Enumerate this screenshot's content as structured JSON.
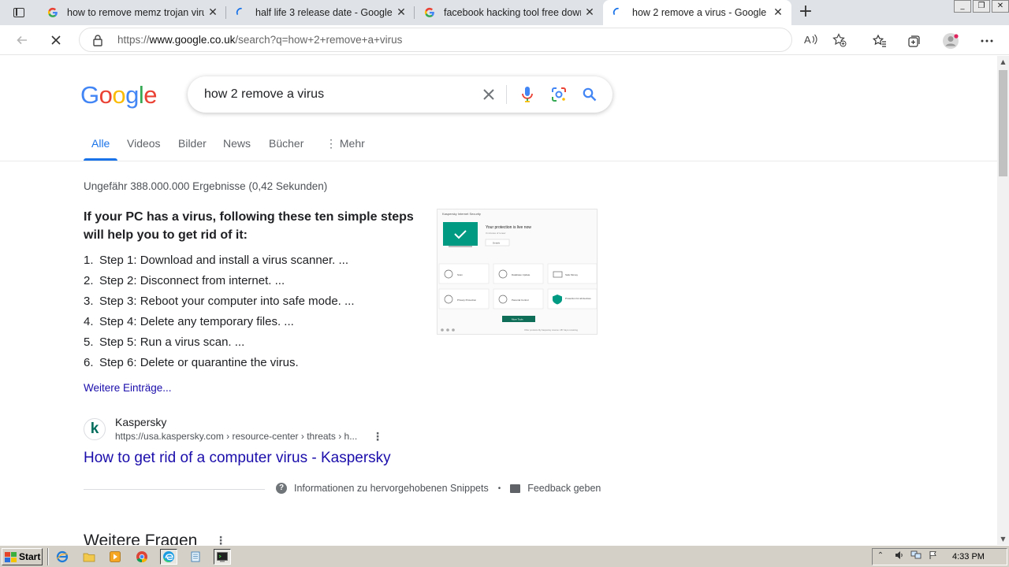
{
  "browser": {
    "tabs": [
      {
        "title": "how to remove memz trojan viru",
        "favicon": "google-g-icon",
        "active": false
      },
      {
        "title": "half life 3 release date - Google Su",
        "favicon": "loading-spinner-icon",
        "active": false
      },
      {
        "title": "facebook hacking tool free down",
        "favicon": "google-g-icon",
        "active": false
      },
      {
        "title": "how 2 remove a virus - Google Su",
        "favicon": "loading-spinner-icon",
        "active": true
      }
    ],
    "new_tab_glyph": "+",
    "close_glyph": "✕",
    "url_prefix": "https://",
    "url_domain": "www.google.co.uk",
    "url_path": "/search?q=how+2+remove+a+virus"
  },
  "google": {
    "query": "how 2 remove a virus",
    "search_tabs": [
      "Alle",
      "Videos",
      "Bilder",
      "News",
      "Bücher",
      "Mehr"
    ],
    "stats": "Ungefähr 388.000.000 Ergebnisse (0,42 Sekunden)",
    "snippet": {
      "heading": "If your PC has a virus, following these ten simple steps will help you to get rid of it:",
      "steps": [
        "Step 1: Download and install a virus scanner. ...",
        "Step 2: Disconnect from internet. ...",
        "Step 3: Reboot your computer into safe mode. ...",
        "Step 4: Delete any temporary files. ...",
        "Step 5: Run a virus scan. ...",
        "Step 6: Delete or quarantine the virus."
      ],
      "more_link": "Weitere Einträge...",
      "image": {
        "title": "Kaspersky Internet Security",
        "status": "Your protection is live now",
        "status_sub": "3 minutes of renew",
        "status_button": "Details",
        "tiles": [
          "Scan",
          "Database Update",
          "Safe Money",
          "Privacy Protection",
          "Parental Control",
          "Protection for all devices"
        ],
        "more_tools": "More Tools",
        "footer_links": "Other products    My Kaspersky    License: 287 days remaining"
      }
    },
    "result": {
      "favicon_letter": "k",
      "site_name": "Kaspersky",
      "breadcrumb": "https://usa.kaspersky.com › resource-center › threats › h...",
      "title": "How to get rid of a computer virus - Kaspersky"
    },
    "footer": {
      "info": "Informationen zu hervorgehobenen Snippets",
      "separator": "•",
      "feedback": "Feedback geben"
    },
    "more_questions": "Weitere Fragen"
  },
  "watermark": "ANY▷RUN",
  "taskbar": {
    "start_label": "Start",
    "clock": "4:33 PM"
  },
  "colors": {
    "link": "#1a0dab",
    "active_tab": "#1a73e8",
    "kaspersky_green": "#009982"
  }
}
